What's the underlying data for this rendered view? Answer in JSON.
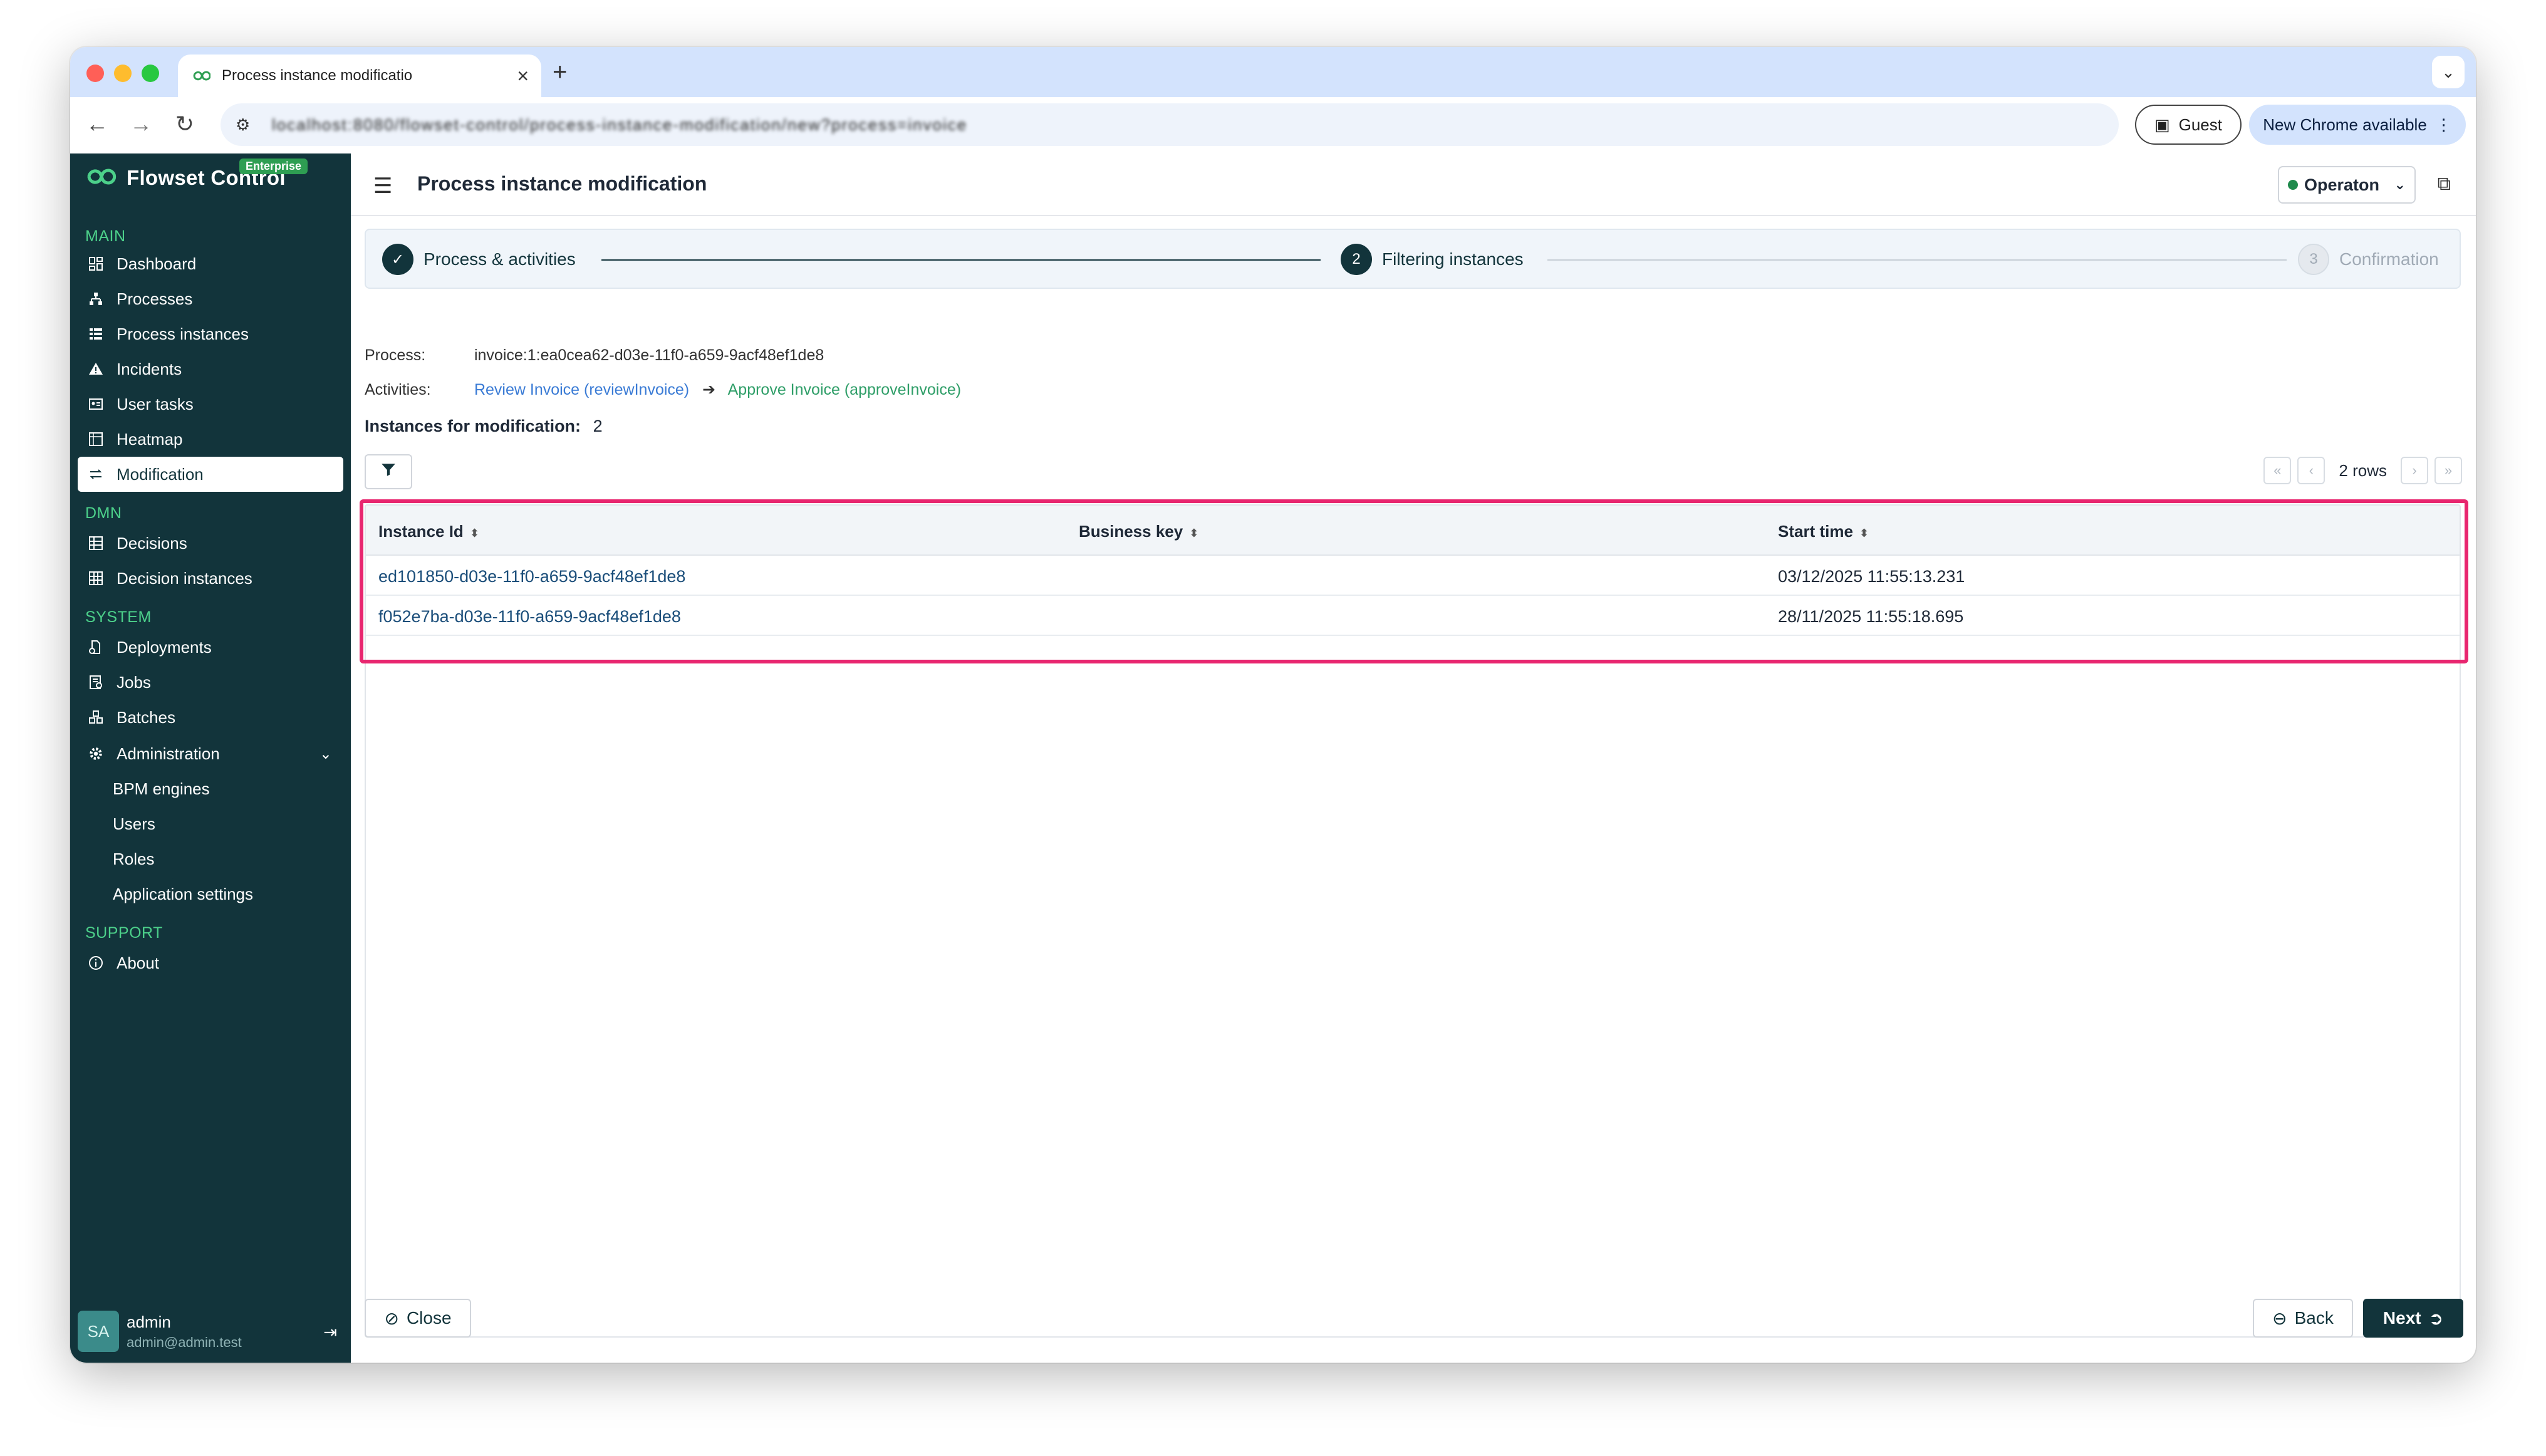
{
  "browser": {
    "tab_title": "Process instance modificatio",
    "new_tab_symbol": "+",
    "tab_close_symbol": "×",
    "url": "localhost:8080/flowset-control/process-instance-modification/new?process=invoice",
    "guest_label": "Guest",
    "update_label": "New Chrome available"
  },
  "sidebar": {
    "brand_name": "Flowset Control",
    "brand_badge": "Enterprise",
    "sections": {
      "main": "MAIN",
      "dmn": "DMN",
      "system": "SYSTEM",
      "support": "SUPPORT"
    },
    "items": {
      "dashboard": "Dashboard",
      "processes": "Processes",
      "process_instances": "Process instances",
      "incidents": "Incidents",
      "user_tasks": "User tasks",
      "heatmap": "Heatmap",
      "modification": "Modification",
      "decisions": "Decisions",
      "decision_instances": "Decision instances",
      "deployments": "Deployments",
      "jobs": "Jobs",
      "batches": "Batches",
      "administration": "Administration",
      "bpm_engines": "BPM engines",
      "users": "Users",
      "roles": "Roles",
      "application_settings": "Application settings",
      "about": "About"
    },
    "user": {
      "initials": "SA",
      "name": "admin",
      "email": "admin@admin.test"
    }
  },
  "header": {
    "title": "Process instance modification",
    "engine": "Operaton"
  },
  "stepper": {
    "step1": {
      "label": "Process & activities",
      "state": "done"
    },
    "step2": {
      "number": "2",
      "label": "Filtering instances",
      "state": "current"
    },
    "step3": {
      "number": "3",
      "label": "Confirmation",
      "state": "pending"
    }
  },
  "info": {
    "process_label": "Process:",
    "process_value": "invoice:1:ea0cea62-d03e-11f0-a659-9acf48ef1de8",
    "activities_label": "Activities:",
    "activity_from": "Review Invoice (reviewInvoice)",
    "activity_to": "Approve Invoice (approveInvoice)",
    "instances_label": "Instances for modification:",
    "instances_count": "2"
  },
  "pager": {
    "rows_text": "2 rows"
  },
  "table": {
    "columns": [
      "Instance Id",
      "Business key",
      "Start time"
    ],
    "rows": [
      {
        "id": "ed101850-d03e-11f0-a659-9acf48ef1de8",
        "business_key": "",
        "start_time": "03/12/2025 11:55:13.231"
      },
      {
        "id": "f052e7ba-d03e-11f0-a659-9acf48ef1de8",
        "business_key": "",
        "start_time": "28/11/2025 11:55:18.695"
      }
    ]
  },
  "footer": {
    "close_label": "Close",
    "back_label": "Back",
    "next_label": "Next"
  },
  "colors": {
    "sidebar_bg": "#12343b",
    "accent_green": "#4cd08a",
    "highlight": "#e8266f",
    "primary": "#12343b"
  }
}
